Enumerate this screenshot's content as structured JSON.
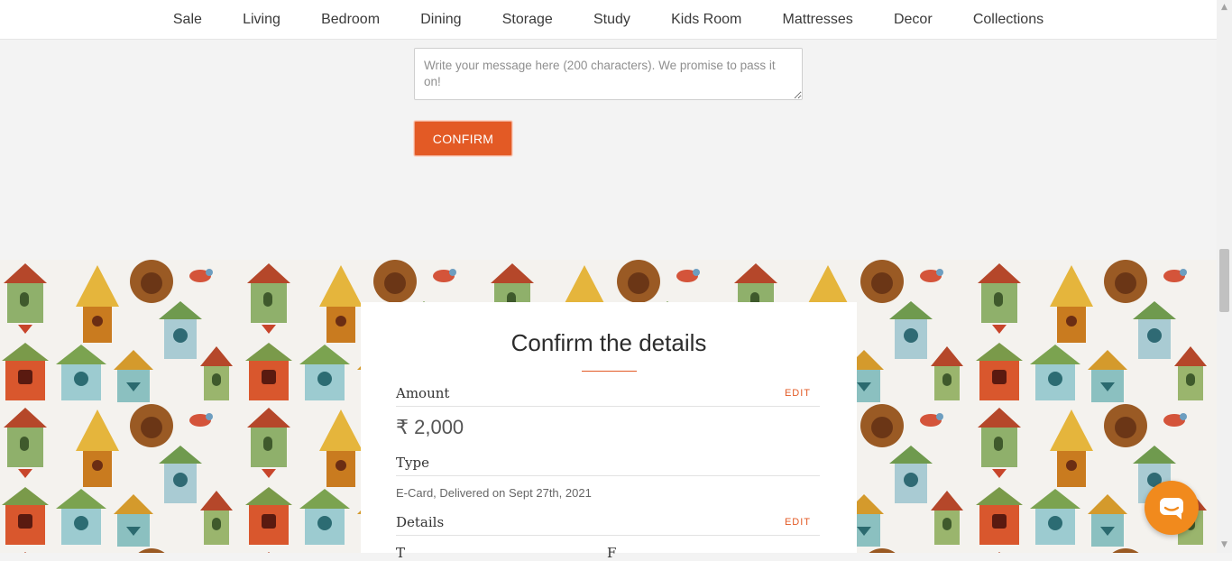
{
  "nav": {
    "items": [
      "Sale",
      "Living",
      "Bedroom",
      "Dining",
      "Storage",
      "Study",
      "Kids Room",
      "Mattresses",
      "Decor",
      "Collections"
    ]
  },
  "message": {
    "placeholder": "Write your message here (200 characters). We promise to pass it on!"
  },
  "confirm_button": "CONFIRM",
  "card": {
    "title": "Confirm the details",
    "amount_label": "Amount",
    "amount_value": "₹ 2,000",
    "type_label": "Type",
    "type_value": "E-Card, Delivered on Sept 27th, 2021",
    "details_label": "Details",
    "edit_label": "EDIT",
    "partial_left": "T",
    "partial_right": "F"
  },
  "icons": {
    "chat": "chat-icon",
    "scroll_up": "arrow-up-icon",
    "scroll_down": "arrow-down-icon"
  },
  "colors": {
    "accent": "#e35a25",
    "chat": "#f18a1d",
    "background": "#f3f3f3"
  }
}
